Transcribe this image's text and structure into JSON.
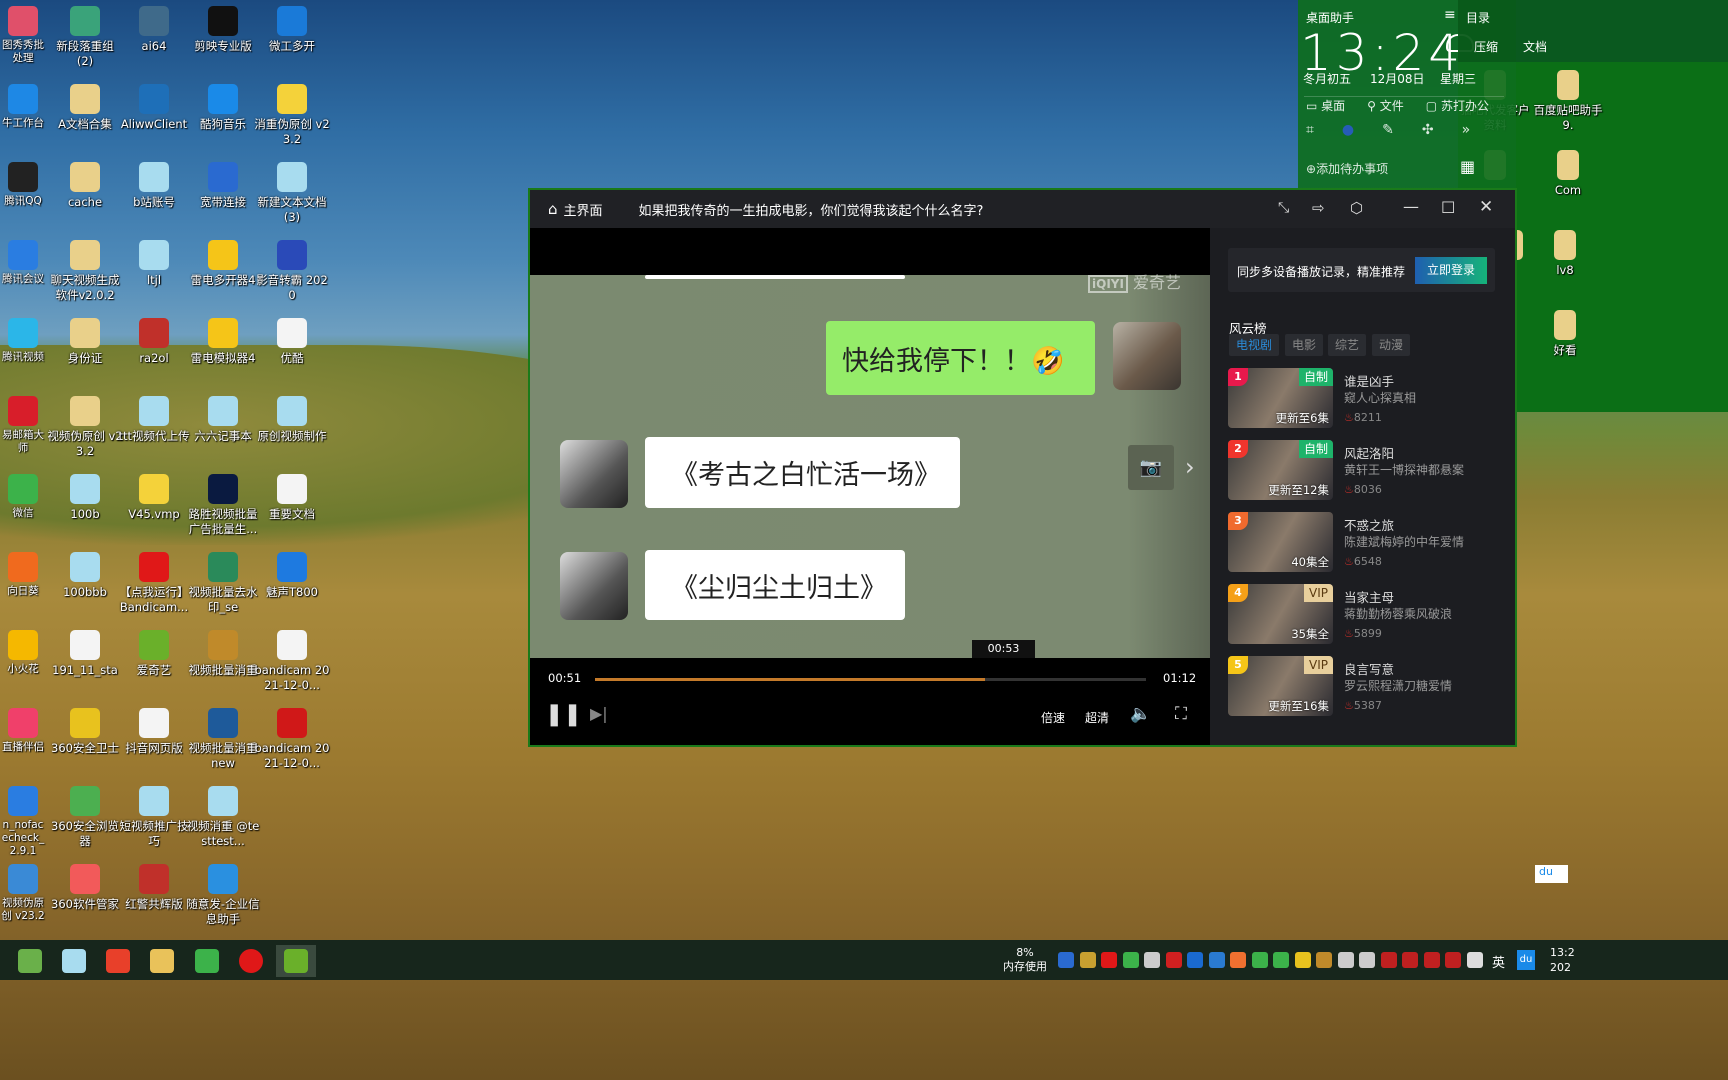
{
  "desktop": {
    "columns": [
      [
        {
          "label": "图秀秀批处理",
          "color": "#e0506a"
        },
        {
          "label": "牛工作台",
          "color": "#1e88e5"
        },
        {
          "label": "腾讯QQ",
          "color": "#222"
        },
        {
          "label": "腾讯会议",
          "color": "#2a7de1"
        },
        {
          "label": "腾讯视频",
          "color": "#2bb6e8"
        },
        {
          "label": "易邮箱大师",
          "color": "#d81e2a"
        },
        {
          "label": "微信",
          "color": "#3cb24a"
        },
        {
          "label": "向日葵",
          "color": "#f06a1e"
        },
        {
          "label": "小火花",
          "color": "#f5b800"
        },
        {
          "label": "直播伴侣",
          "color": "#f0406a"
        },
        {
          "label": "n_nofacecheck_2.9.1",
          "color": "#2a7de1"
        },
        {
          "label": "视频伪原创 v23.2",
          "color": "#3a8ad6"
        }
      ],
      [
        {
          "label": "新段落重组 (2)",
          "color": "#3aa37a"
        },
        {
          "label": "A文档合集",
          "color": "#e9d08a"
        },
        {
          "label": "cache",
          "color": "#e9d08a"
        },
        {
          "label": "聊天视频生成软件v2.0.2",
          "color": "#e9d08a"
        },
        {
          "label": "身份证",
          "color": "#e9d08a"
        },
        {
          "label": "视频伪原创 v23.2",
          "color": "#e9d08a"
        },
        {
          "label": "100b",
          "color": "#a8dcef"
        },
        {
          "label": "100bbb",
          "color": "#a8dcef"
        },
        {
          "label": "191_11_sta",
          "color": "#f4f4f4"
        },
        {
          "label": "360安全卫士",
          "color": "#e8c21e"
        },
        {
          "label": "360安全浏览器",
          "color": "#4caf50"
        },
        {
          "label": "360软件管家",
          "color": "#f25a5a"
        }
      ],
      [
        {
          "label": "ai64",
          "color": "#3f6a8a"
        },
        {
          "label": "AliwwClient",
          "color": "#1e6fb8"
        },
        {
          "label": "b站账号",
          "color": "#a8dcef"
        },
        {
          "label": "ltjl",
          "color": "#a8dcef"
        },
        {
          "label": "ra2ol",
          "color": "#c0302a"
        },
        {
          "label": "ttt视频代上传",
          "color": "#a8dcef"
        },
        {
          "label": "V45.vmp",
          "color": "#f4d23a"
        },
        {
          "label": "【点我运行】Bandicam...",
          "color": "#e01818"
        },
        {
          "label": "爱奇艺",
          "color": "#6ab02a"
        },
        {
          "label": "抖音网页版",
          "color": "#f4f4f4"
        },
        {
          "label": "短视频推广技巧",
          "color": "#a8dcef"
        },
        {
          "label": "红警共辉版",
          "color": "#c0302a"
        }
      ],
      [
        {
          "label": "剪映专业版",
          "color": "#111"
        },
        {
          "label": "酷狗音乐",
          "color": "#1a8ae8"
        },
        {
          "label": "宽带连接",
          "color": "#2a6ad0"
        },
        {
          "label": "雷电多开器4",
          "color": "#f5c518"
        },
        {
          "label": "雷电模拟器4",
          "color": "#f5c518"
        },
        {
          "label": "六六记事本",
          "color": "#a8dcef"
        },
        {
          "label": "路胜视频批量广告批量生...",
          "color": "#0a1a40"
        },
        {
          "label": "视频批量去水印_se",
          "color": "#2a8a5a"
        },
        {
          "label": "视频批量消重",
          "color": "#c08a2a"
        },
        {
          "label": "视频批量消重 new",
          "color": "#1e5a9a"
        },
        {
          "label": "视频消重 @testtest...",
          "color": "#a8dcef"
        },
        {
          "label": "随意发-企业信息助手",
          "color": "#2a90e0"
        }
      ],
      [
        {
          "label": "微工多开",
          "color": "#1a7ad8"
        },
        {
          "label": "消重伪原创 v23.2",
          "color": "#f4d23a"
        },
        {
          "label": "新建文本文档 (3)",
          "color": "#a8dcef"
        },
        {
          "label": "影音转霸 2020",
          "color": "#2a4ab8"
        },
        {
          "label": "优酷",
          "color": "#f4f4f4"
        },
        {
          "label": "原创视频制作",
          "color": "#a8dcef"
        },
        {
          "label": "重要文档",
          "color": "#f4f4f4"
        },
        {
          "label": "魅声T800",
          "color": "#1e7ae0"
        },
        {
          "label": "bandicam 2021-12-0...",
          "color": "#f4f4f4"
        },
        {
          "label": "bandicam 2021-12-0...",
          "color": "#d01818"
        }
      ]
    ],
    "right_icons": [
      {
        "label": "猫吧代发客户资料"
      },
      {
        "label": "百度贴吧助手9."
      },
      {
        "label": "-"
      },
      {
        "label": "Com"
      },
      {
        "label": ")"
      },
      {
        "label": "lv8"
      },
      {
        "label": "好看"
      }
    ],
    "floating_badge": "du"
  },
  "widget": {
    "title": "桌面助手",
    "time": "13:24",
    "lunar": "冬月初五",
    "date": "12月08日",
    "weekday": "星期三",
    "shortcuts": [
      "桌面",
      "文件",
      "苏打办公"
    ],
    "todo": "添加待办事项",
    "catalog_title": "目录",
    "catalog_tabs": [
      "压缩",
      "文档"
    ]
  },
  "player": {
    "home": "主界面",
    "title": "如果把我传奇的一生拍成电影，你们觉得我该起个什么名字?",
    "watermark": "爱奇艺",
    "watermark_logo": "iQIYI",
    "chat": {
      "me": "快给我停下！！🤣",
      "reply1": "《考古之白忙活一场》",
      "reply2": "《尘归尘土归土》"
    },
    "hover_time": "00:53",
    "current_time": "00:51",
    "total_time": "01:12",
    "progress": 0.708,
    "speed": "倍速",
    "quality": "超清",
    "colors": {
      "progress": "#c47a2a",
      "login_from": "#1f5fb0",
      "login_to": "#16b37a"
    }
  },
  "sidebar": {
    "login_text": "同步多设备播放记录，精准推荐",
    "login_button": "立即登录",
    "section": "风云榜",
    "tabs": [
      "电视剧",
      "电影",
      "综艺",
      "动漫"
    ],
    "active_tab": "电视剧",
    "items": [
      {
        "rank": "1",
        "title": "谁是凶手",
        "subtitle": "窥人心探真相",
        "heat": "8211",
        "tag": "自制",
        "episodes": "更新至6集",
        "rank_color": "#e8194c"
      },
      {
        "rank": "2",
        "title": "风起洛阳",
        "subtitle": "黄轩王一博探神都悬案",
        "heat": "8036",
        "tag": "自制",
        "episodes": "更新至12集",
        "rank_color": "#f0352d"
      },
      {
        "rank": "3",
        "title": "不惑之旅",
        "subtitle": "陈建斌梅婷的中年爱情",
        "heat": "6548",
        "tag": "",
        "episodes": "40集全",
        "rank_color": "#f06a2e"
      },
      {
        "rank": "4",
        "title": "当家主母",
        "subtitle": "蒋勤勤杨蓉乘风破浪",
        "heat": "5899",
        "tag": "VIP",
        "episodes": "35集全",
        "rank_color": "#f5a018"
      },
      {
        "rank": "5",
        "title": "良言写意",
        "subtitle": "罗云熙程潇刀糖爱情",
        "heat": "5387",
        "tag": "VIP",
        "episodes": "更新至16集",
        "rank_color": "#f5c518"
      }
    ]
  },
  "taskbar": {
    "apps": [
      {
        "name": "360-browser",
        "color": "#6ab04a"
      },
      {
        "name": "notepad",
        "color": "#a8dcef"
      },
      {
        "name": "xmind",
        "color": "#e8402a"
      },
      {
        "name": "explorer",
        "color": "#e9c25a"
      },
      {
        "name": "wechat",
        "color": "#3cb24a"
      },
      {
        "name": "bandicam",
        "color": "#e01818"
      },
      {
        "name": "iqiyi",
        "color": "#6ab02a"
      }
    ],
    "memory_pct": "8%",
    "memory_label": "内存使用",
    "ime": "英",
    "du": "du",
    "clock_time": "13:2",
    "clock_date": "202"
  }
}
